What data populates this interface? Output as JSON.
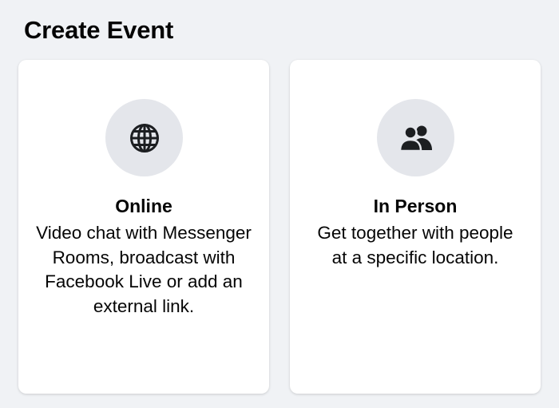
{
  "header": {
    "title": "Create Event"
  },
  "options": [
    {
      "title": "Online",
      "description": "Video chat with Messenger Rooms, broadcast with Facebook Live or add an external link.",
      "icon": "globe-icon"
    },
    {
      "title": "In Person",
      "description": "Get together with people at a specific location.",
      "icon": "people-icon"
    }
  ],
  "colors": {
    "background": "#f0f2f5",
    "card": "#ffffff",
    "icon_circle": "#e4e6eb",
    "text": "#050505",
    "icon": "#1c1e21"
  }
}
